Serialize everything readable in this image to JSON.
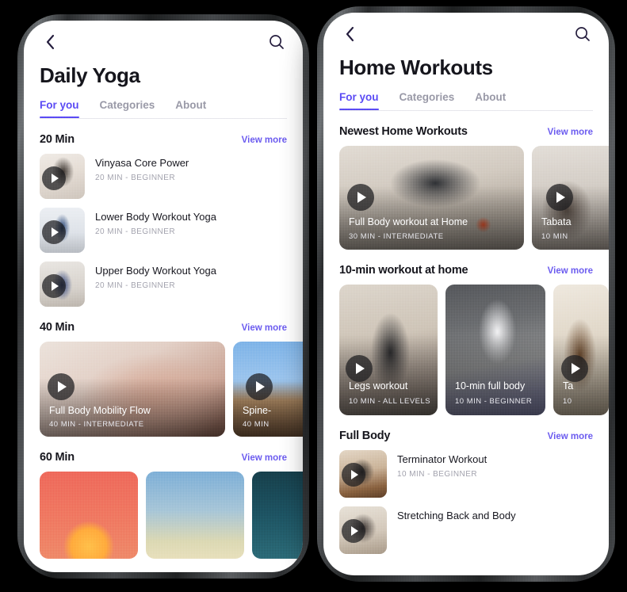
{
  "accent": "#5b4bf5",
  "phones": [
    {
      "id": "left",
      "title": "Daily Yoga",
      "tabs": [
        {
          "label": "For you",
          "active": true
        },
        {
          "label": "Categories",
          "active": false
        },
        {
          "label": "About",
          "active": false
        }
      ],
      "sections": [
        {
          "title": "20 Min",
          "view_more": "View more",
          "layout": "list",
          "items": [
            {
              "title": "Vinyasa Core Power",
              "meta": "20 MIN - BEGINNER"
            },
            {
              "title": "Lower Body Workout Yoga",
              "meta": "20 MIN - BEGINNER"
            },
            {
              "title": "Upper Body Workout Yoga",
              "meta": "20 MIN - BEGINNER"
            }
          ]
        },
        {
          "title": "40 Min",
          "view_more": "View more",
          "layout": "carousel",
          "items": [
            {
              "title": "Full Body Mobility Flow",
              "meta": "40 MIN - INTERMEDIATE"
            },
            {
              "title": "Spine-",
              "meta": "40 MIN"
            }
          ]
        },
        {
          "title": "60 Min",
          "view_more": "View more",
          "layout": "carousel-plain",
          "items": [
            {
              "title": "",
              "meta": ""
            },
            {
              "title": "",
              "meta": ""
            },
            {
              "title": "",
              "meta": ""
            }
          ]
        }
      ]
    },
    {
      "id": "right",
      "title": "Home Workouts",
      "tabs": [
        {
          "label": "For you",
          "active": true
        },
        {
          "label": "Categories",
          "active": false
        },
        {
          "label": "About",
          "active": false
        }
      ],
      "sections": [
        {
          "title": "Newest Home Workouts",
          "view_more": "View more",
          "layout": "carousel",
          "items": [
            {
              "title": "Full Body workout at Home",
              "meta": "30 MIN - INTERMEDIATE"
            },
            {
              "title": "Tabata",
              "meta": "10 MIN"
            }
          ]
        },
        {
          "title": "10-min workout at home",
          "view_more": "View more",
          "layout": "carousel",
          "items": [
            {
              "title": "Legs workout",
              "meta": "10 MIN - ALL LEVELS"
            },
            {
              "title": "10-min full body",
              "meta": "10 MIN - BEGINNER"
            },
            {
              "title": "Ta",
              "meta": "10"
            }
          ]
        },
        {
          "title": "Full Body",
          "view_more": "View more",
          "layout": "list",
          "items": [
            {
              "title": "Terminator Workout",
              "meta": "10 MIN - BEGINNER"
            },
            {
              "title": "Stretching Back and Body",
              "meta": ""
            }
          ]
        }
      ]
    }
  ]
}
